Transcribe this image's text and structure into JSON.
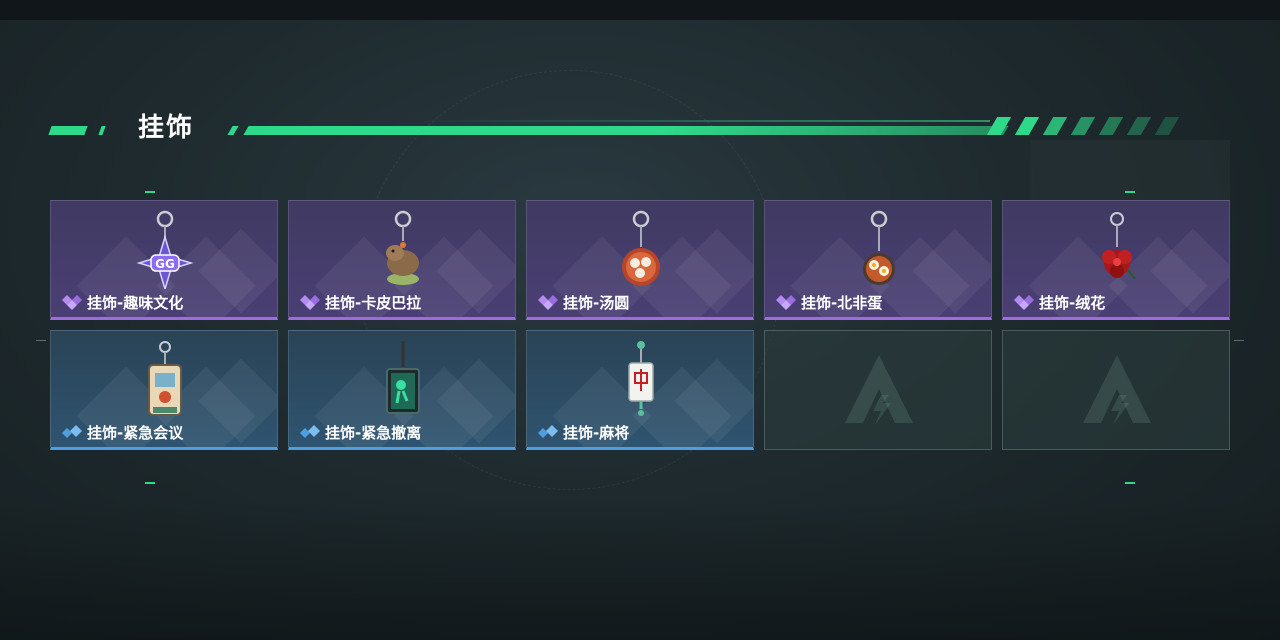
{
  "header": {
    "title": "挂饰"
  },
  "colors": {
    "accent": "#2fd98a",
    "purple_rarity": "#9a6de0",
    "blue_rarity": "#4f9fe0"
  },
  "items": [
    {
      "label": "挂饰-趣味文化",
      "rarity": "purple",
      "icon": "gg-star-charm-icon"
    },
    {
      "label": "挂饰-卡皮巴拉",
      "rarity": "purple",
      "icon": "capybara-charm-icon"
    },
    {
      "label": "挂饰-汤圆",
      "rarity": "purple",
      "icon": "tangyuan-bowl-charm-icon"
    },
    {
      "label": "挂饰-北非蛋",
      "rarity": "purple",
      "icon": "shakshuka-pan-charm-icon"
    },
    {
      "label": "挂饰-绒花",
      "rarity": "purple",
      "icon": "red-velvet-flower-charm-icon"
    },
    {
      "label": "挂饰-紧急会议",
      "rarity": "blue",
      "icon": "emergency-meeting-charm-icon"
    },
    {
      "label": "挂饰-紧急撤离",
      "rarity": "blue",
      "icon": "emergency-evacuation-charm-icon"
    },
    {
      "label": "挂饰-麻将",
      "rarity": "blue",
      "icon": "mahjong-tile-charm-icon"
    }
  ],
  "empty_slots": 2
}
